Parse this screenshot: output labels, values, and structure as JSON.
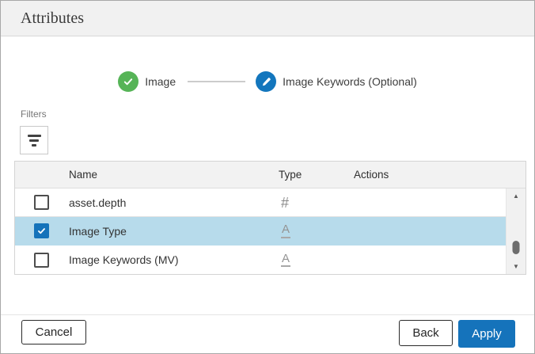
{
  "dialog": {
    "title": "Attributes"
  },
  "stepper": {
    "steps": [
      {
        "label": "Image",
        "state": "complete",
        "icon": "check-icon"
      },
      {
        "label": "Image Keywords (Optional)",
        "state": "current",
        "icon": "pencil-icon"
      }
    ]
  },
  "filters": {
    "label": "Filters",
    "button_icon": "filter-icon"
  },
  "table": {
    "columns": [
      "Name",
      "Type",
      "Actions"
    ],
    "rows": [
      {
        "name": "asset.depth",
        "type": "number",
        "type_glyph": "#",
        "checked": false,
        "selected": false,
        "actions": ""
      },
      {
        "name": "Image Type",
        "type": "text",
        "type_glyph": "A",
        "checked": true,
        "selected": true,
        "actions": ""
      },
      {
        "name": "Image Keywords (MV)",
        "type": "text",
        "type_glyph": "A",
        "checked": false,
        "selected": false,
        "actions": ""
      }
    ],
    "scrollbar": {
      "up_arrow": "▲",
      "down_arrow": "▼"
    }
  },
  "footer": {
    "cancel_label": "Cancel",
    "back_label": "Back",
    "apply_label": "Apply"
  },
  "colors": {
    "accent_blue": "#1573bb",
    "success_green": "#56b457",
    "selected_row": "#b7dbeb",
    "header_bg": "#f1f1f1"
  }
}
